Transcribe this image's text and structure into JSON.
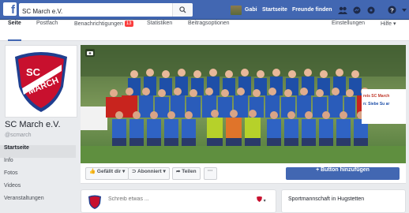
{
  "topbar": {
    "logo": "f",
    "search_value": "SC March e.V.",
    "user_name": "Gabi",
    "links": [
      "Startseite",
      "Freunde finden"
    ],
    "icons": [
      "friend-requests-icon",
      "messages-icon",
      "notifications-icon",
      "help-icon",
      "menu-chevron-icon"
    ]
  },
  "tabs": {
    "items": [
      "Seite",
      "Postfach",
      "Benachrichtigungen",
      "Statistiken",
      "Beitragsoptionen"
    ],
    "notifications_badge": "13",
    "right": [
      "Einstellungen",
      "Hilfe ▾"
    ]
  },
  "page": {
    "name": "SC March e.V.",
    "handle": "@scmarch",
    "crest_text": [
      "SC",
      "MARCH"
    ]
  },
  "sidebar": {
    "items": [
      "Startseite",
      "Info",
      "Fotos",
      "Videos",
      "Veranstaltungen"
    ]
  },
  "cover": {
    "banner_text": [
      "reis SC March",
      "n: Siebe Su ar"
    ]
  },
  "actions": {
    "like": "Gefällt dir ▾",
    "follow": "Abonniert ▾",
    "share": "Teilen",
    "more": "···",
    "cta": "+ Button hinzufügen"
  },
  "composer": {
    "placeholder": "Schreib etwas ...",
    "control": "▾"
  },
  "info": {
    "category": "Sportmannschaft in Hugstetten"
  },
  "colors": {
    "brand": "#4267b2",
    "badge": "#fa3e3e",
    "crest_red": "#c8102e",
    "crest_blue": "#1f3f8f"
  }
}
